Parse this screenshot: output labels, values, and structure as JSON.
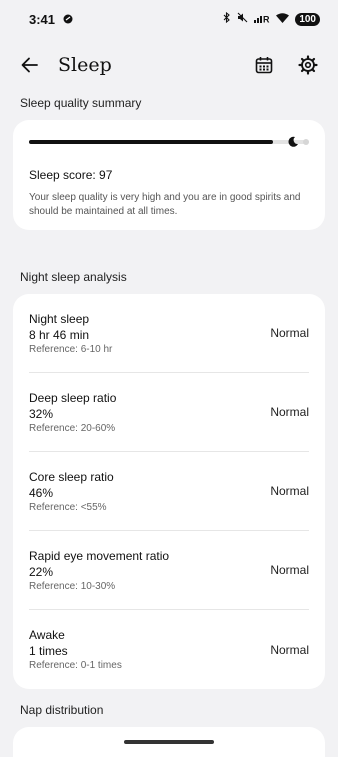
{
  "status": {
    "time": "3:41",
    "battery": "100"
  },
  "header": {
    "title": "Sleep",
    "back_icon": "arrow-left-icon",
    "calendar_icon": "calendar-icon",
    "settings_icon": "gear-icon"
  },
  "summary": {
    "section_title": "Sleep quality summary",
    "score_progress_percent": 97,
    "score_label": "Sleep score: 97",
    "description": "Your sleep quality is very high and you are in good spirits and should be maintained at all times."
  },
  "analysis": {
    "section_title": "Night sleep analysis",
    "rows": [
      {
        "name": "Night sleep",
        "value": "8 hr 46 min",
        "reference": "Reference: 6-10 hr",
        "status": "Normal"
      },
      {
        "name": "Deep sleep ratio",
        "value": "32%",
        "reference": "Reference: 20-60%",
        "status": "Normal"
      },
      {
        "name": "Core sleep ratio",
        "value": "46%",
        "reference": "Reference: <55%",
        "status": "Normal"
      },
      {
        "name": "Rapid eye movement ratio",
        "value": "22%",
        "reference": "Reference: 10-30%",
        "status": "Normal"
      },
      {
        "name": "Awake",
        "value": "1 times",
        "reference": "Reference: 0-1 times",
        "status": "Normal"
      }
    ]
  },
  "nap": {
    "section_title": "Nap distribution"
  }
}
